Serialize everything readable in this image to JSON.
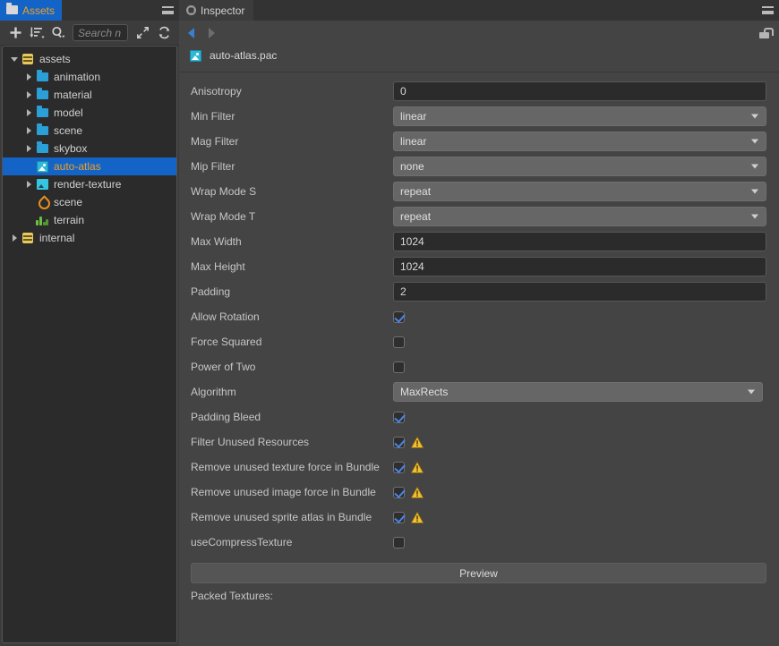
{
  "assets_panel": {
    "tab": {
      "label": "Assets",
      "icon": "folder-icon"
    },
    "menu_icon": "hamburger-menu-icon",
    "toolbar": {
      "add_icon": "plus-icon",
      "sort_icon": "sort-icon",
      "filter_icon": "search-filter-icon",
      "collapse_icon": "collapse-all-icon",
      "refresh_icon": "refresh-icon"
    },
    "search": {
      "placeholder": "Search n",
      "value": ""
    },
    "tree": [
      {
        "label": "assets",
        "icon": "database-icon",
        "depth": 0,
        "twisty": "down",
        "selected": false
      },
      {
        "label": "animation",
        "icon": "folder-icon",
        "depth": 1,
        "twisty": "right",
        "selected": false
      },
      {
        "label": "material",
        "icon": "folder-icon",
        "depth": 1,
        "twisty": "right",
        "selected": false
      },
      {
        "label": "model",
        "icon": "folder-icon",
        "depth": 1,
        "twisty": "right",
        "selected": false
      },
      {
        "label": "scene",
        "icon": "folder-icon",
        "depth": 1,
        "twisty": "right",
        "selected": false
      },
      {
        "label": "skybox",
        "icon": "folder-icon",
        "depth": 1,
        "twisty": "right",
        "selected": false
      },
      {
        "label": "auto-atlas",
        "icon": "image-icon",
        "depth": 1,
        "twisty": "none",
        "selected": true
      },
      {
        "label": "render-texture",
        "icon": "render-texture-icon",
        "depth": 1,
        "twisty": "right",
        "selected": false
      },
      {
        "label": "scene",
        "icon": "scene-drop-icon",
        "depth": 1,
        "twisty": "none",
        "selected": false
      },
      {
        "label": "terrain",
        "icon": "terrain-icon",
        "depth": 1,
        "twisty": "none",
        "selected": false
      },
      {
        "label": "internal",
        "icon": "database-icon",
        "depth": 0,
        "twisty": "right",
        "selected": false
      }
    ]
  },
  "inspector": {
    "tab": {
      "label": "Inspector",
      "icon": "gear-icon"
    },
    "menu_icon": "hamburger-menu-icon",
    "nav": {
      "back_icon": "arrow-left-icon",
      "forward_icon": "arrow-right-icon",
      "lock_icon": "unlock-icon"
    },
    "asset": {
      "name": "auto-atlas.pac",
      "icon": "image-icon"
    },
    "properties": [
      {
        "label": "Anisotropy",
        "type": "input",
        "value": "0"
      },
      {
        "label": "Min Filter",
        "type": "select",
        "value": "linear"
      },
      {
        "label": "Mag Filter",
        "type": "select",
        "value": "linear"
      },
      {
        "label": "Mip Filter",
        "type": "select",
        "value": "none"
      },
      {
        "label": "Wrap Mode S",
        "type": "select",
        "value": "repeat"
      },
      {
        "label": "Wrap Mode T",
        "type": "select",
        "value": "repeat"
      },
      {
        "label": "Max Width",
        "type": "input",
        "value": "1024"
      },
      {
        "label": "Max Height",
        "type": "input",
        "value": "1024"
      },
      {
        "label": "Padding",
        "type": "input",
        "value": "2"
      },
      {
        "label": "Allow Rotation",
        "type": "checkbox",
        "checked": true,
        "warning": false
      },
      {
        "label": "Force Squared",
        "type": "checkbox",
        "checked": false,
        "warning": false
      },
      {
        "label": "Power of Two",
        "type": "checkbox",
        "checked": false,
        "warning": false
      },
      {
        "label": "Algorithm",
        "type": "select-narrow",
        "value": "MaxRects"
      },
      {
        "label": "Padding Bleed",
        "type": "checkbox",
        "checked": true,
        "warning": false
      },
      {
        "label": "Filter Unused Resources",
        "type": "checkbox",
        "checked": true,
        "warning": true
      },
      {
        "label": "Remove unused texture force in Bundle",
        "type": "checkbox",
        "checked": true,
        "warning": true
      },
      {
        "label": "Remove unused image force in Bundle",
        "type": "checkbox",
        "checked": true,
        "warning": true
      },
      {
        "label": "Remove unused sprite atlas in Bundle",
        "type": "checkbox",
        "checked": true,
        "warning": true
      },
      {
        "label": "useCompressTexture",
        "type": "checkbox",
        "checked": false,
        "warning": false
      }
    ],
    "preview_button": "Preview",
    "packed_textures_label": "Packed Textures:"
  },
  "colors": {
    "accent_blue": "#1464c8",
    "selected_text": "#f0a020",
    "warning_yellow": "#f0c030",
    "checkbox_check": "#4a86e8",
    "panel_bg": "#444444",
    "tree_bg": "#2b2b2b"
  }
}
